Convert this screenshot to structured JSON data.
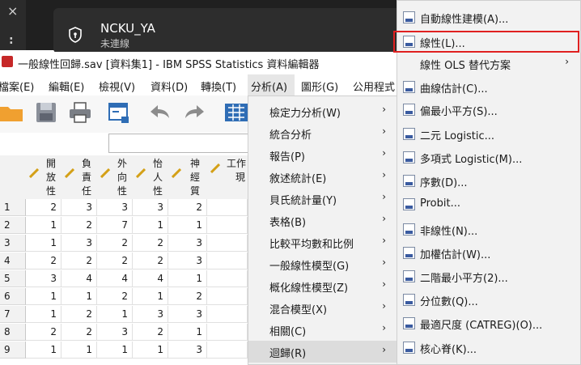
{
  "vpn": {
    "name": "NCKU_YA",
    "status": "未連線",
    "close_glyph": "×",
    "more_glyph": ":"
  },
  "window": {
    "title": "一般線性回歸.sav [資料集1] - IBM SPSS Statistics 資料編輯器"
  },
  "menubar": [
    "檔案(E)",
    "編輯(E)",
    "檢視(V)",
    "資料(D)",
    "轉換(T)",
    "分析(A)",
    "圖形(G)",
    "公用程式"
  ],
  "grid": {
    "columns": [
      [
        "開",
        "放",
        "性"
      ],
      [
        "負",
        "責",
        "任"
      ],
      [
        "外",
        "向",
        "性"
      ],
      [
        "怡",
        "人",
        "性"
      ],
      [
        "神",
        "經",
        "質"
      ],
      [
        "工作",
        "現"
      ]
    ],
    "row_numbers": [
      "1",
      "2",
      "3",
      "4",
      "5",
      "6",
      "7",
      "8",
      "9"
    ],
    "rows": [
      [
        "2",
        "3",
        "3",
        "3",
        "2"
      ],
      [
        "1",
        "2",
        "7",
        "1",
        "1"
      ],
      [
        "1",
        "3",
        "2",
        "2",
        "3"
      ],
      [
        "2",
        "2",
        "2",
        "2",
        "3"
      ],
      [
        "3",
        "4",
        "4",
        "4",
        "1"
      ],
      [
        "1",
        "1",
        "2",
        "1",
        "2"
      ],
      [
        "1",
        "2",
        "1",
        "3",
        "3"
      ],
      [
        "2",
        "2",
        "3",
        "2",
        "1"
      ],
      [
        "1",
        "1",
        "1",
        "1",
        "3"
      ]
    ]
  },
  "analyze_menu": [
    "檢定力分析(W)",
    "統合分析",
    "報告(P)",
    "敘述統計(E)",
    "貝氏統計量(Y)",
    "表格(B)",
    "比較平均數和比例",
    "一般線性模型(G)",
    "概化線性模型(Z)",
    "混合模型(X)",
    "相關(C)",
    "迴歸(R)"
  ],
  "analyze_arrows": [
    "›",
    "›",
    "›",
    "›",
    "›",
    "›",
    "›",
    "›",
    "›",
    "›",
    "›",
    "›"
  ],
  "regression_menu": [
    "自動線性建模(A)...",
    "線性(L)...",
    "線性 OLS 替代方案",
    "曲線估計(C)...",
    "偏最小平方(S)...",
    "二元 Logistic...",
    "多項式 Logistic(M)...",
    "序數(D)...",
    "Probit...",
    "非線性(N)...",
    "加權估計(W)...",
    "二階最小平方(2)...",
    "分位數(Q)...",
    "最適尺度 (CATREG)(O)...",
    "核心脊(K)..."
  ],
  "regression_arrow": "›",
  "colors": {
    "highlight": "#e02020",
    "menu_bg": "#f2f2f2",
    "vpn_bg": "#202020"
  }
}
